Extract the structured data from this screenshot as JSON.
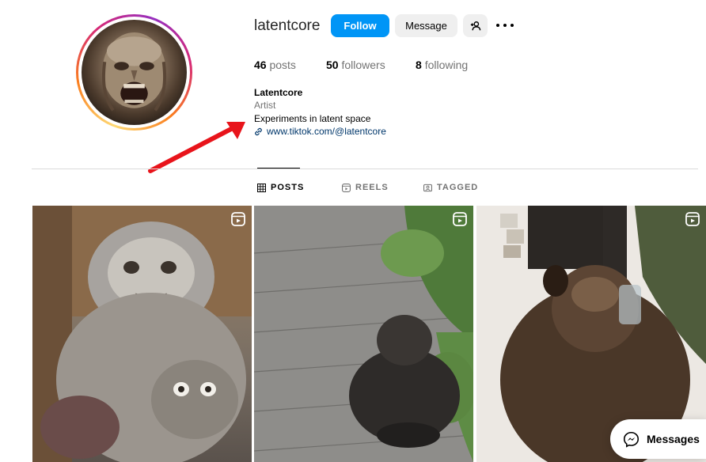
{
  "profile": {
    "username": "latentcore",
    "follow_label": "Follow",
    "message_label": "Message",
    "stats": {
      "posts_count": "46",
      "posts_label": "posts",
      "followers_count": "50",
      "followers_label": "followers",
      "following_count": "8",
      "following_label": "following"
    },
    "bio": {
      "name": "Latentcore",
      "category": "Artist",
      "text": "Experiments in latent space",
      "link": "www.tiktok.com/@latentcore"
    }
  },
  "tabs": [
    {
      "label": "POSTS",
      "icon": "grid-icon",
      "active": true
    },
    {
      "label": "REELS",
      "icon": "reels-icon",
      "active": false
    },
    {
      "label": "TAGGED",
      "icon": "tagged-icon",
      "active": false
    }
  ],
  "posts": [
    {
      "icon": "reel-badge-icon"
    },
    {
      "icon": "reel-badge-icon"
    },
    {
      "icon": "reel-badge-icon"
    }
  ],
  "messages": {
    "label": "Messages",
    "icon": "messenger-icon"
  },
  "colors": {
    "follow_button": "#0095f6",
    "secondary_button": "#efefef",
    "link": "#00376b",
    "annotation_arrow": "#e8141b"
  }
}
